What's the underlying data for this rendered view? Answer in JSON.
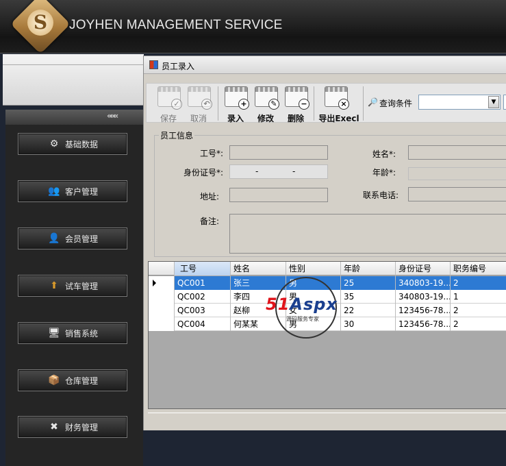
{
  "header": {
    "brand": "JOYHEN MANAGEMENT SERVICE",
    "logo_letter": "S"
  },
  "sidebar": {
    "collapse_glyph": "«««",
    "items": [
      {
        "label": "基础数据",
        "icon": "gear-icon",
        "glyph": "⚙"
      },
      {
        "label": "客户管理",
        "icon": "users-icon",
        "glyph": "👥"
      },
      {
        "label": "会员管理",
        "icon": "person-icon",
        "glyph": "👤"
      },
      {
        "label": "试车管理",
        "icon": "car-icon",
        "glyph": "⬆"
      },
      {
        "label": "销售系统",
        "icon": "monitor-icon",
        "glyph": "🖥"
      },
      {
        "label": "仓库管理",
        "icon": "warehouse-icon",
        "glyph": "📦"
      },
      {
        "label": "财务管理",
        "icon": "finance-icon",
        "glyph": "✖"
      }
    ]
  },
  "window": {
    "title": "员工录入",
    "toolbar": {
      "save": "保存",
      "cancel": "取消",
      "add": "录入",
      "edit": "修改",
      "delete": "删除",
      "export": "导出Execl",
      "query_label": "查询条件"
    },
    "form": {
      "legend": "员工信息",
      "emp_id_label": "工号*:",
      "name_label": "姓名*:",
      "idcard_label": "身份证号*:",
      "idcard_sep1": "-",
      "idcard_sep2": "-",
      "age_label": "年龄*:",
      "address_label": "地址:",
      "phone_label": "联系电话:",
      "remark_label": "备注:"
    },
    "grid": {
      "columns": [
        "工号",
        "姓名",
        "性别",
        "年龄",
        "身份证号",
        "职务编号"
      ],
      "rows": [
        [
          "QC001",
          "张三",
          "男",
          "25",
          "340803-19...",
          "2"
        ],
        [
          "QC002",
          "李四",
          "男",
          "35",
          "340803-19...",
          "1"
        ],
        [
          "QC003",
          "赵柳",
          "女",
          "22",
          "123456-78...",
          "2"
        ],
        [
          "QC004",
          "何某某",
          "男",
          "30",
          "123456-78...",
          "2"
        ]
      ],
      "selected_row": 0
    }
  },
  "watermark": {
    "text_a": "51",
    "text_b": "Aspx",
    "sub": "源码服务专家"
  }
}
